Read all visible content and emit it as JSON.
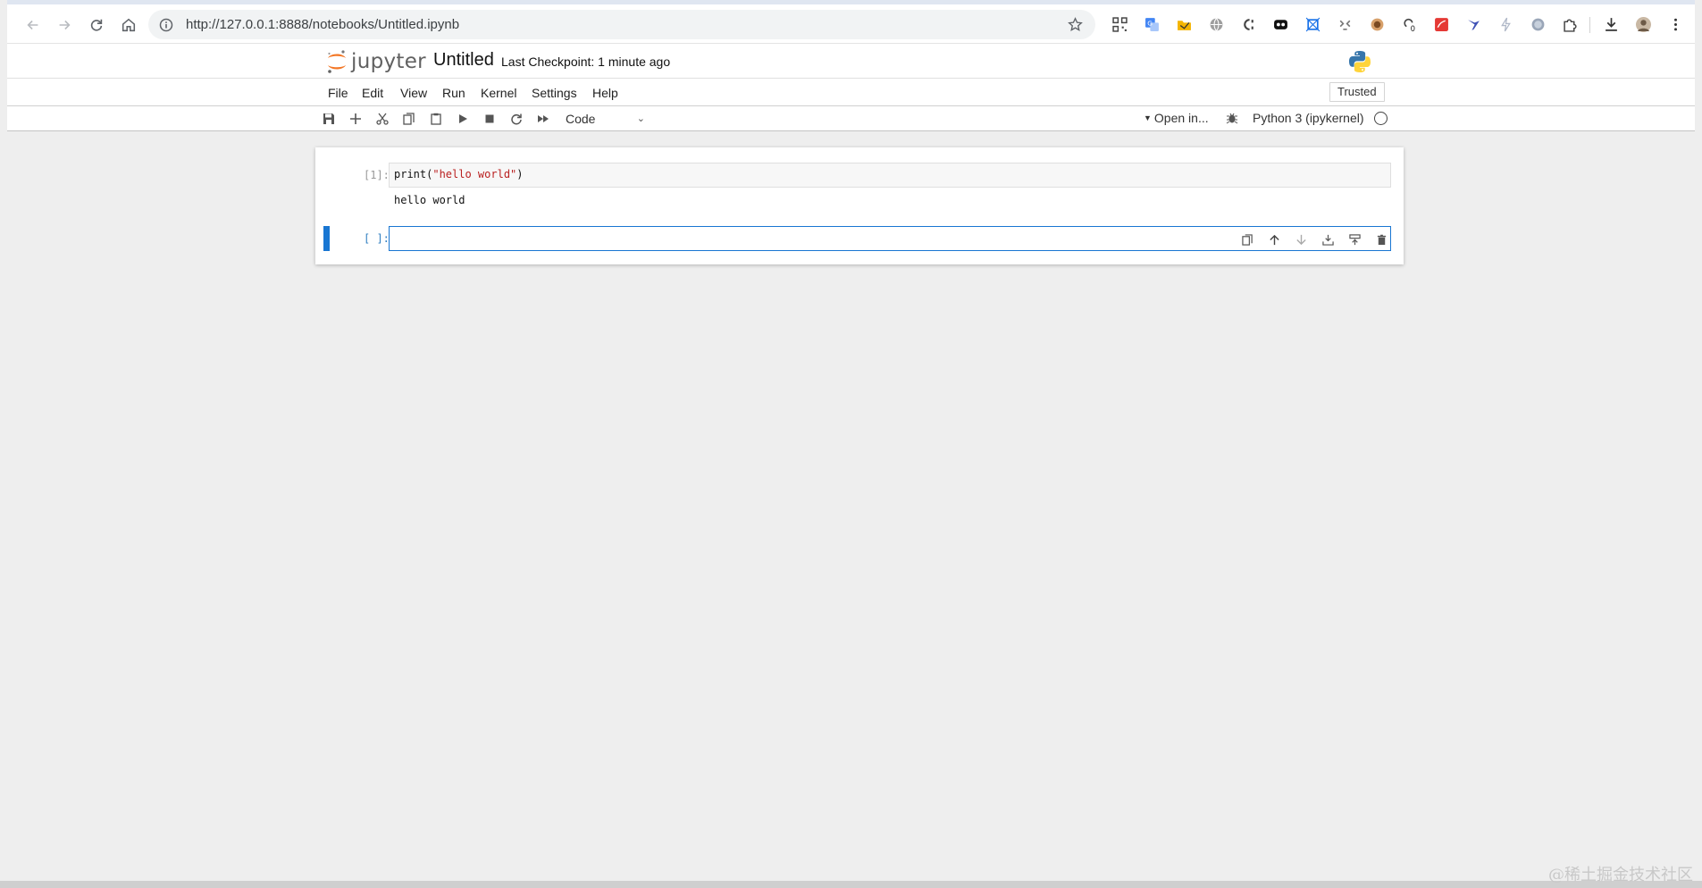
{
  "browser": {
    "url": "http://127.0.0.1:8888/notebooks/Untitled.ipynb",
    "extensions": [
      "qr-icon",
      "translate-icon",
      "folder-icon",
      "globe-icon",
      "code-icon",
      "media-icon",
      "crop-icon",
      "robot-icon",
      "coffee-icon",
      "cloud-icon",
      "pdf-icon",
      "bird-icon",
      "bolt-icon",
      "circle-icon",
      "puzzle-icon"
    ],
    "cloud_badge": "0"
  },
  "jupyter": {
    "logo_text": "jupyter",
    "notebook_title": "Untitled",
    "checkpoint": "Last Checkpoint: 1 minute ago",
    "menu": [
      "File",
      "Edit",
      "View",
      "Run",
      "Kernel",
      "Settings",
      "Help"
    ],
    "trusted": "Trusted",
    "cell_type": "Code",
    "open_in": "Open in...",
    "kernel": "Python 3 (ipykernel)"
  },
  "cells": [
    {
      "prompt": "[1]:",
      "code_fn": "print(",
      "code_str": "\"hello world\"",
      "code_end": ")",
      "output": "hello world"
    },
    {
      "prompt": "[ ]:",
      "code": ""
    }
  ],
  "watermark": "@稀土掘金技术社区",
  "colors": {
    "accent": "#1976d2",
    "string": "#ba2121",
    "jupyter_orange": "#f37726"
  }
}
